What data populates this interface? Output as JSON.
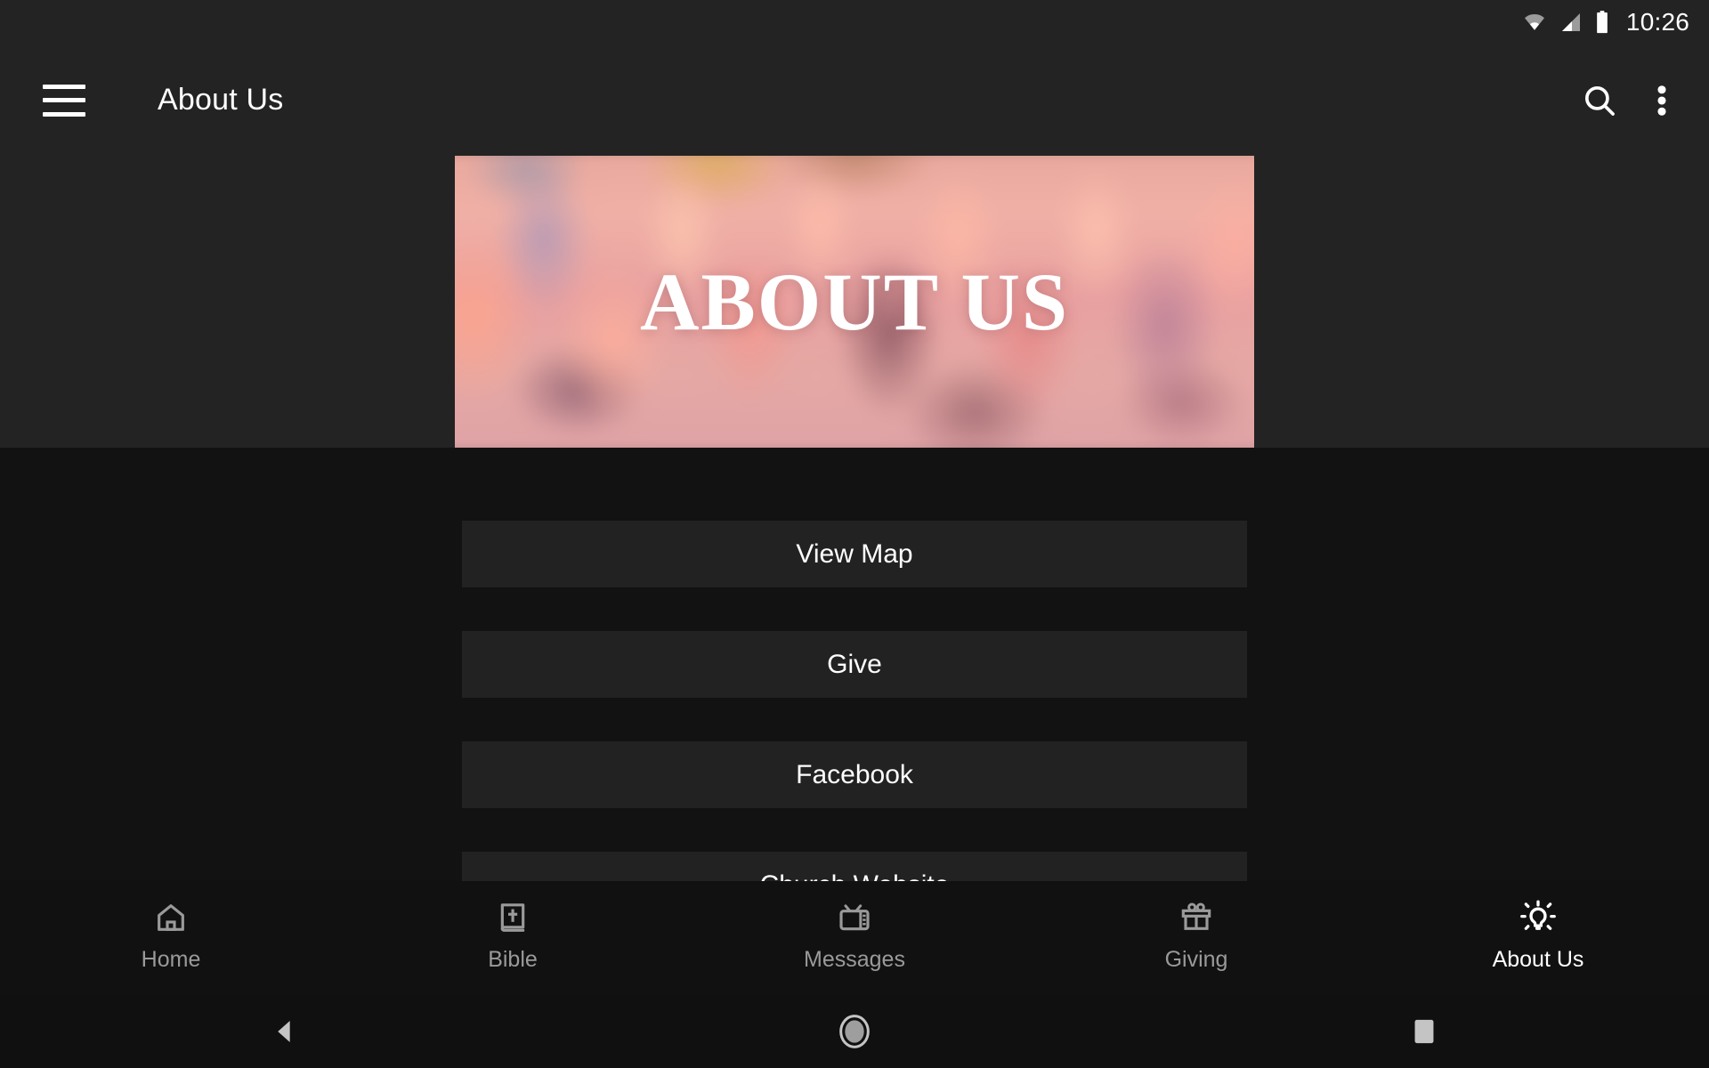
{
  "status_bar": {
    "time": "10:26",
    "icons": [
      "wifi-icon",
      "cellular-signal-icon",
      "battery-icon"
    ]
  },
  "app_bar": {
    "menu_icon": "hamburger-menu-icon",
    "title": "About Us",
    "search_icon": "search-icon",
    "overflow_icon": "more-vertical-icon"
  },
  "hero": {
    "title": "ABOUT US",
    "image_description": "blurred crowd photograph with pink and salmon tones"
  },
  "main": {
    "buttons": [
      {
        "label": "View Map"
      },
      {
        "label": "Give"
      },
      {
        "label": "Facebook"
      },
      {
        "label": "Church Website"
      }
    ]
  },
  "tab_bar": {
    "tabs": [
      {
        "label": "Home",
        "icon": "home-icon",
        "active": false
      },
      {
        "label": "Bible",
        "icon": "bible-icon",
        "active": false
      },
      {
        "label": "Messages",
        "icon": "tv-icon",
        "active": false
      },
      {
        "label": "Giving",
        "icon": "gift-icon",
        "active": false
      },
      {
        "label": "About Us",
        "icon": "lightbulb-icon",
        "active": true
      }
    ]
  },
  "system_nav": {
    "back": "back-triangle-icon",
    "home": "home-circle-icon",
    "recents": "recents-square-icon"
  },
  "colors": {
    "app_bar_background": "#232323",
    "content_background": "#121212",
    "button_background": "#222222",
    "tab_bar_background": "#111111",
    "active_tab": "#ffffff",
    "inactive_tab": "#9a9a9a"
  }
}
